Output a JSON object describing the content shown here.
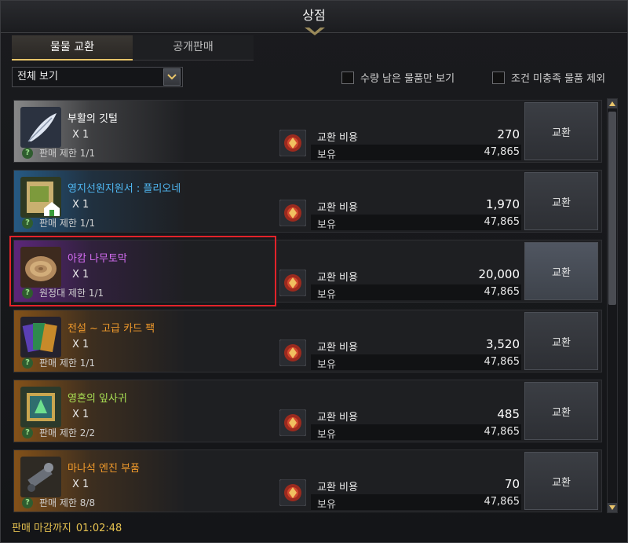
{
  "window": {
    "title": "상점"
  },
  "tabs": [
    {
      "label": "물물 교환",
      "active": true
    },
    {
      "label": "공개판매",
      "active": false
    }
  ],
  "filter": {
    "selected": "전체 보기"
  },
  "options": [
    {
      "label": "수량 남은 물품만 보기",
      "checked": false
    },
    {
      "label": "조건 미충족 물품 제외",
      "checked": false
    }
  ],
  "items": [
    {
      "name": "부활의 깃털",
      "name_color": "#ffffff",
      "qty": "X 1",
      "limit": "판매 제한 1/1",
      "cost_label": "교환 비용",
      "cost": "270",
      "hold_label": "보유",
      "hold": "47,865",
      "button": "교환",
      "grade_color": "#bcbcbc",
      "icon": "feather-icon"
    },
    {
      "name": "영지선원지원서 : 플리오네",
      "name_color": "#4fb6f0",
      "qty": "X 1",
      "limit": "판매 제한 1/1",
      "cost_label": "교환 비용",
      "cost": "1,970",
      "hold_label": "보유",
      "hold": "47,865",
      "button": "교환",
      "grade_color": "#2a77b4",
      "icon": "scroll-icon"
    },
    {
      "name": "아캄 나무토막",
      "name_color": "#d46df2",
      "qty": "X 1",
      "limit": "원정대 제한 1/1",
      "cost_label": "교환 비용",
      "cost": "20,000",
      "hold_label": "보유",
      "hold": "47,865",
      "button": "교환",
      "grade_color": "#7a2aa5",
      "icon": "wood-log-icon",
      "selected": true
    },
    {
      "name": "전설 ~ 고급 카드 팩",
      "name_color": "#f09a2b",
      "qty": "X 1",
      "limit": "판매 제한 1/1",
      "cost_label": "교환 비용",
      "cost": "3,520",
      "hold_label": "보유",
      "hold": "47,865",
      "button": "교환",
      "grade_color": "#b66a14",
      "icon": "card-pack-icon"
    },
    {
      "name": "영혼의 잎사귀",
      "name_color": "#a9e054",
      "qty": "X 1",
      "limit": "판매 제한 2/2",
      "cost_label": "교환 비용",
      "cost": "485",
      "hold_label": "보유",
      "hold": "47,865",
      "button": "교환",
      "grade_color": "#b66a14",
      "icon": "leaf-gem-icon"
    },
    {
      "name": "마나석 엔진 부품",
      "name_color": "#f09a2b",
      "qty": "X 1",
      "limit": "판매 제한 8/8",
      "cost_label": "교환 비용",
      "cost": "70",
      "hold_label": "보유",
      "hold": "47,865",
      "button": "교환",
      "grade_color": "#b66a14",
      "icon": "engine-part-icon"
    }
  ],
  "footer": {
    "deadline_label": "판매 마감까지",
    "deadline_time": "01:02:48"
  }
}
